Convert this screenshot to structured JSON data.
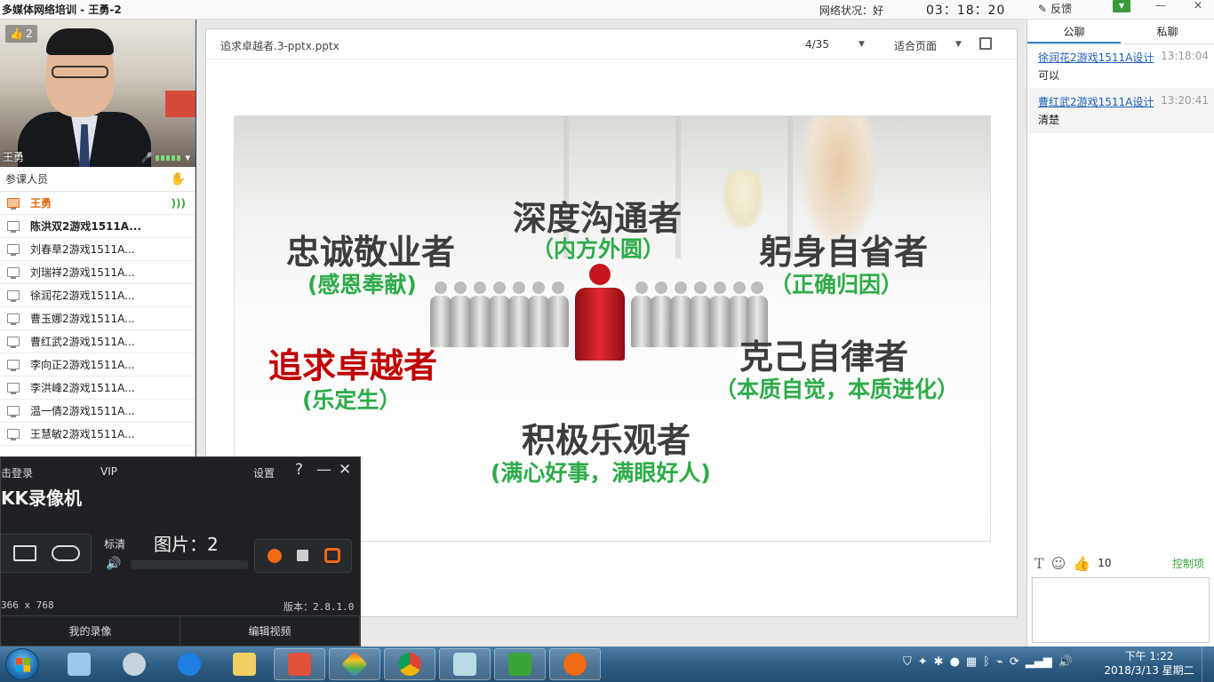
{
  "app": {
    "title": "多媒体网络培训 - 王勇-2",
    "network_label": "网络状况：",
    "network_status": "好",
    "session_timer": "03：18：20",
    "feedback_label": "反馈"
  },
  "video": {
    "likes": "2",
    "speaker_name": "王勇"
  },
  "members": {
    "header": "参课人员",
    "list": [
      {
        "name": "王勇"
      },
      {
        "name": "陈洪双2游戏1511A..."
      },
      {
        "name": "刘春草2游戏1511A..."
      },
      {
        "name": "刘瑞祥2游戏1511A..."
      },
      {
        "name": "徐润花2游戏1511A..."
      },
      {
        "name": "曹玉娜2游戏1511A..."
      },
      {
        "name": "曹红武2游戏1511A..."
      },
      {
        "name": "李向正2游戏1511A..."
      },
      {
        "name": "李洪峰2游戏1511A..."
      },
      {
        "name": "温一倩2游戏1511A..."
      },
      {
        "name": "王慧敏2游戏1511A..."
      }
    ]
  },
  "document": {
    "filename": "追求卓越者.3-pptx.pptx",
    "page_indicator": "4/35",
    "zoom_mode": "适合页面"
  },
  "slide": {
    "items": [
      {
        "heading": "深度沟通者",
        "sub": "（内方外圆）"
      },
      {
        "heading": "忠诚敬业者",
        "sub": "(感恩奉献)"
      },
      {
        "heading": "躬身自省者",
        "sub": "（正确归因）"
      },
      {
        "heading": "追求卓越者",
        "sub": "(乐定生）"
      },
      {
        "heading": "克己自律者",
        "sub": "（本质自觉，本质进化）"
      },
      {
        "heading": "积极乐观者",
        "sub": "(满心好事，满眼好人)"
      }
    ]
  },
  "chat": {
    "tabs": [
      {
        "label": "公聊"
      },
      {
        "label": "私聊"
      }
    ],
    "messages": [
      {
        "sender": "徐润花2游戏1511A设计",
        "time": "13:18:04",
        "text": "可以"
      },
      {
        "sender": "曹红武2游戏1511A设计",
        "time": "13:20:41",
        "text": "清楚"
      }
    ],
    "like_count": "10",
    "control_label": "控制项"
  },
  "recorder": {
    "login_label": "击登录",
    "vip_label": "VIP",
    "settings_label": "设置",
    "help_label": "?",
    "minimize_label": "—",
    "close_label": "✕",
    "brand": "KK录像机",
    "quality_label": "标清",
    "picture_count_label": "图片：2",
    "resolution": "366 x 768",
    "version": "版本：2.8.1.0",
    "my_recordings_label": "我的录像",
    "edit_video_label": "编辑视频"
  },
  "taskbar": {
    "time": "下午 1:22",
    "date": "2018/3/13 星期二"
  },
  "colors": {
    "slide_heading": "#3d3d3d",
    "slide_sub": "#2eab4a",
    "slide_highlight": "#c00000",
    "chat_link": "#1b5fb8",
    "host_orange": "#e86a12",
    "recorder_bg": "#1f2124"
  },
  "icons": {
    "thumbs_up": "thumbs-up-icon",
    "hand_raise": "hand-raise-icon",
    "mic": "mic-icon",
    "fullscreen": "fullscreen-icon",
    "text_format": "text-format-icon",
    "emoji": "emoji-icon"
  }
}
